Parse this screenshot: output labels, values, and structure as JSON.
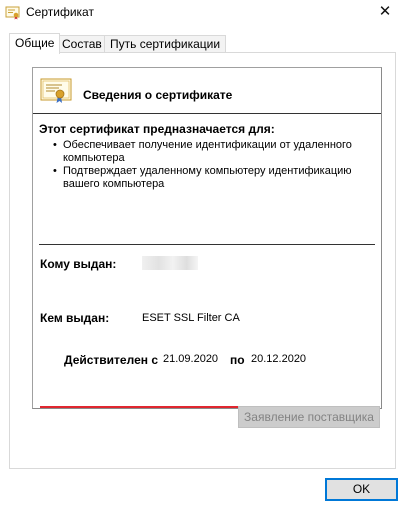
{
  "window": {
    "title": "Сертификат",
    "close_glyph": "✕"
  },
  "tabs": [
    {
      "label": "Общие",
      "active": true
    },
    {
      "label": "Состав",
      "active": false
    },
    {
      "label": "Путь сертификации",
      "active": false
    }
  ],
  "certificate": {
    "header": "Сведения о сертификате",
    "purpose_title": "Этот сертификат предназначается для:",
    "purposes": [
      "Обеспечивает получение идентификации от удаленного компьютера",
      "Подтверждает удаленному компьютеру идентификацию вашего компьютера"
    ],
    "bullet": "•",
    "issued_to_label": "Кому выдан:",
    "issued_by_label": "Кем выдан:",
    "issued_by_value": "ESET SSL Filter CA",
    "valid_from_label": "Действителен с",
    "valid_from": "21.09.2020",
    "valid_to_label": "по",
    "valid_to": "20.12.2020"
  },
  "buttons": {
    "issuer_statement": "Заявление поставщика",
    "ok": "OK"
  },
  "colors": {
    "highlight_underline": "#e0262f",
    "ok_border": "#0078d7",
    "seal": "#d9a12b",
    "ribbon": "#3b6fc4"
  },
  "icons": {
    "title": "certificate-icon",
    "header": "certificate-icon",
    "close": "close-icon"
  }
}
